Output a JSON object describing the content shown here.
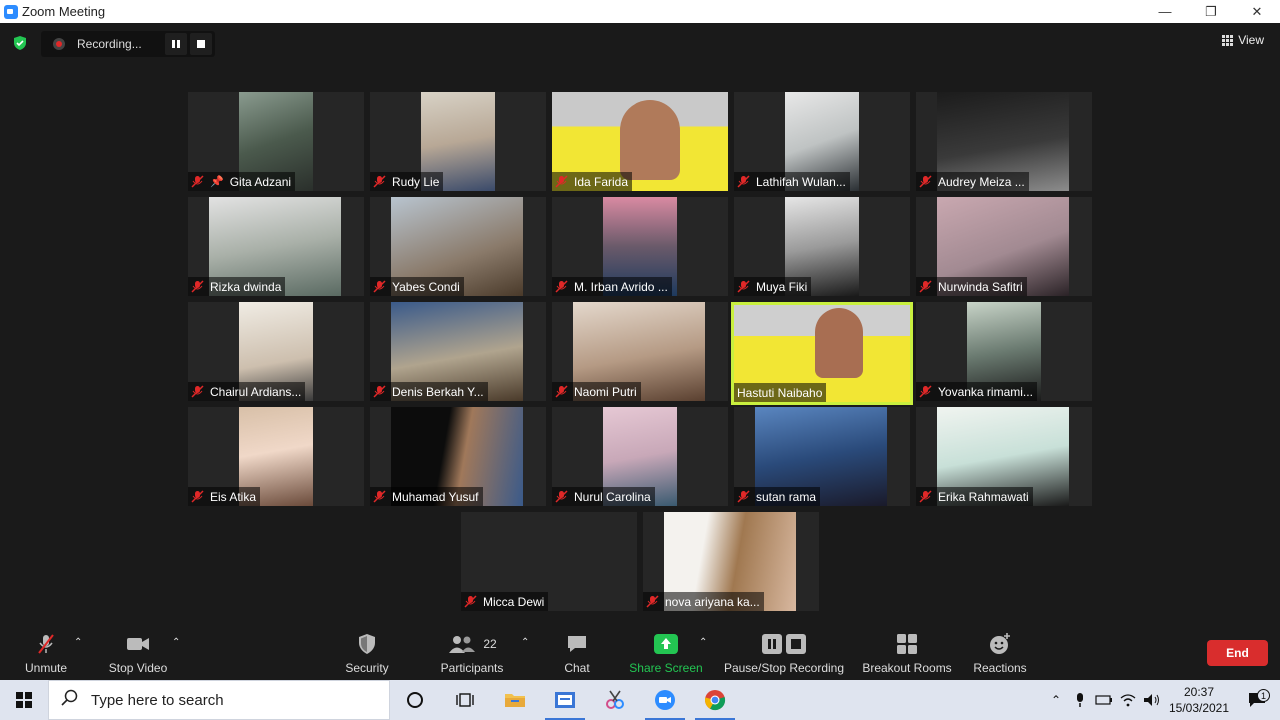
{
  "window": {
    "title": "Zoom Meeting",
    "minimize": "—",
    "maximize": "❐",
    "close": "✕"
  },
  "recording": {
    "label": "Recording..."
  },
  "view": {
    "label": "View"
  },
  "participants_grid": [
    {
      "name": "Gita Adzani",
      "pinned": true
    },
    {
      "name": "Rudy Lie"
    },
    {
      "name": "Ida Farida"
    },
    {
      "name": "Lathifah Wulan..."
    },
    {
      "name": "Audrey Meiza ..."
    },
    {
      "name": "Rizka dwinda"
    },
    {
      "name": "Yabes Condi"
    },
    {
      "name": "M. Irban Avrido ..."
    },
    {
      "name": "Muya Fiki"
    },
    {
      "name": "Nurwinda Safitri"
    },
    {
      "name": "Chairul Ardians..."
    },
    {
      "name": "Denis Berkah Y..."
    },
    {
      "name": "Naomi Putri"
    },
    {
      "name": "Hastuti Naibaho",
      "active_speaker": true
    },
    {
      "name": "Yovanka rimami..."
    },
    {
      "name": "Eis Atika"
    },
    {
      "name": "Muhamad Yusuf"
    },
    {
      "name": "Nurul Carolina"
    },
    {
      "name": "sutan rama"
    },
    {
      "name": "Erika Rahmawati"
    },
    {
      "name": "Micca Dewi"
    },
    {
      "name": "nova ariyana ka..."
    }
  ],
  "toolbar": {
    "unmute": "Unmute",
    "stop_video": "Stop Video",
    "security": "Security",
    "participants": "Participants",
    "participants_count": "22",
    "chat": "Chat",
    "share_screen": "Share Screen",
    "pause_stop_recording": "Pause/Stop Recording",
    "breakout_rooms": "Breakout Rooms",
    "reactions": "Reactions",
    "end": "End"
  },
  "taskbar": {
    "search_placeholder": "Type here to search",
    "time": "20:37",
    "date": "15/03/2021",
    "notification_count": "1"
  },
  "colors": {
    "active_speaker_border": "#c9f03f",
    "share_screen_green": "#23c552",
    "end_red": "#d92d2d",
    "muted_red": "#e02828"
  }
}
